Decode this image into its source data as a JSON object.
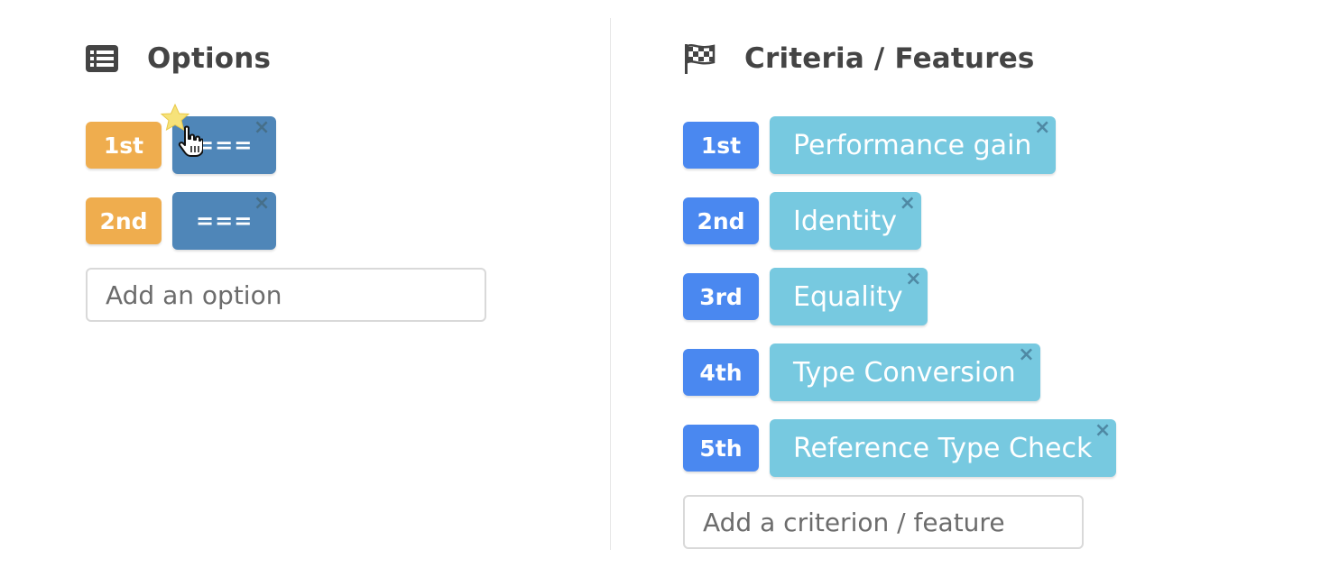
{
  "options": {
    "title": "Options",
    "icon": "list-icon",
    "items": [
      {
        "rank": "1st",
        "label": "==="
      },
      {
        "rank": "2nd",
        "label": "==="
      }
    ],
    "close_glyph": "×",
    "add_placeholder": "Add an option"
  },
  "criteria": {
    "title": "Criteria / Features",
    "icon": "checkered-flag-icon",
    "items": [
      {
        "rank": "1st",
        "label": "Performance gain"
      },
      {
        "rank": "2nd",
        "label": "Identity"
      },
      {
        "rank": "3rd",
        "label": "Equality"
      },
      {
        "rank": "4th",
        "label": "Type Conversion"
      },
      {
        "rank": "5th",
        "label": "Reference Type Check"
      }
    ],
    "close_glyph": "×",
    "add_placeholder": "Add a criterion / feature"
  },
  "colors": {
    "option_rank": "#efad4e",
    "option_chip": "#4f86b8",
    "criterion_rank": "#4a88f0",
    "criterion_chip": "#77c9e0"
  }
}
